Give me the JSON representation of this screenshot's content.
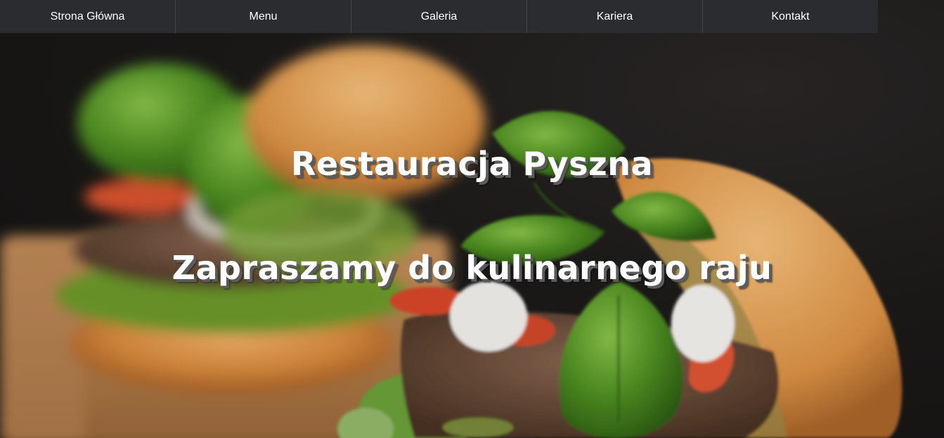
{
  "nav": {
    "items": [
      {
        "label": "Strona Główna"
      },
      {
        "label": "Menu"
      },
      {
        "label": "Galeria"
      },
      {
        "label": "Kariera"
      },
      {
        "label": "Kontakt"
      }
    ]
  },
  "hero": {
    "title": "Restauracja Pyszna",
    "subtitle": "Zapraszamy do kulinarnego raju",
    "image": "burger-photo"
  },
  "colors": {
    "nav_background": "#2b2c30",
    "nav_divider": "#45464b",
    "text": "#ffffff",
    "text_shadow": "#5b5b5b"
  }
}
